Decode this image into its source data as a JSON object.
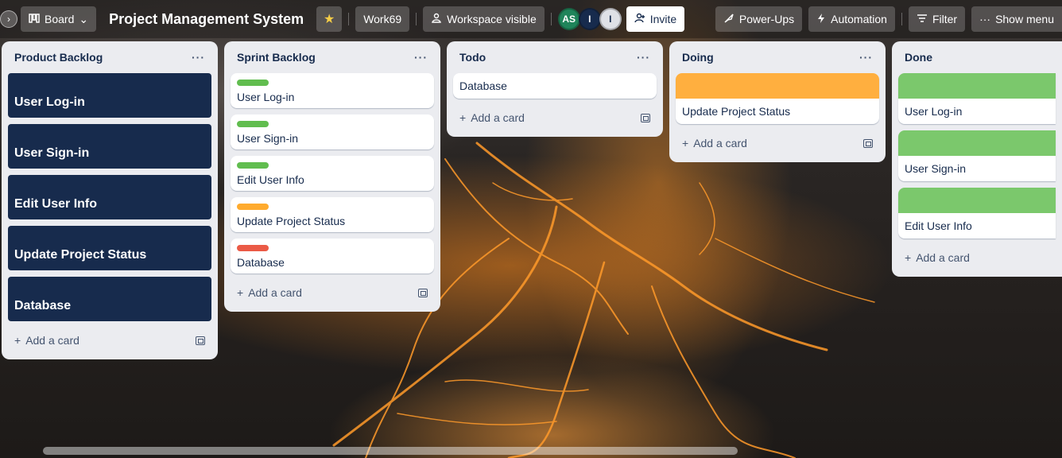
{
  "header": {
    "board_switcher_label": "Board",
    "title": "Project Management System",
    "workspace_name": "Work69",
    "visibility_label": "Workspace visible",
    "avatars": [
      {
        "initials": "AS",
        "bg": "#1f845a",
        "fg": "#ffffff"
      },
      {
        "initials": "I",
        "bg": "#172b4d",
        "fg": "#ffffff"
      },
      {
        "initials": "I",
        "bg": "#dfe1e6",
        "fg": "#172b4d"
      }
    ],
    "invite_label": "Invite",
    "powerups_label": "Power-Ups",
    "automation_label": "Automation",
    "filter_label": "Filter",
    "show_menu_label": "Show menu"
  },
  "colors": {
    "green": "#61bd4f",
    "orange": "#ffab2e",
    "red": "#eb5a46",
    "dark_card": "#172b4d",
    "cover_green": "#7bc86c",
    "cover_orange": "#ffaf3f"
  },
  "lists": [
    {
      "title": "Product Backlog",
      "menu": "···",
      "cards": [
        "User Log-in",
        "User Sign-in",
        "Edit User Info",
        "Update Project Status",
        "Database"
      ],
      "add_label": "Add a card"
    },
    {
      "title": "Sprint Backlog",
      "menu": "···",
      "cards": [
        {
          "title": "User Log-in",
          "label": "green"
        },
        {
          "title": "User Sign-in",
          "label": "green"
        },
        {
          "title": "Edit User Info",
          "label": "green"
        },
        {
          "title": "Update Project Status",
          "label": "orange"
        },
        {
          "title": "Database",
          "label": "red"
        }
      ],
      "add_label": "Add a card"
    },
    {
      "title": "Todo",
      "menu": "···",
      "cards": [
        "Database"
      ],
      "add_label": "Add a card"
    },
    {
      "title": "Doing",
      "menu": "···",
      "cards": [
        {
          "title": "Update Project Status",
          "cover": "orange"
        }
      ],
      "add_label": "Add a card"
    },
    {
      "title": "Done",
      "menu": "···",
      "cards": [
        {
          "title": "User Log-in",
          "cover": "green"
        },
        {
          "title": "User Sign-in",
          "cover": "green"
        },
        {
          "title": "Edit User Info",
          "cover": "green"
        }
      ],
      "add_label": "Add a card"
    }
  ]
}
